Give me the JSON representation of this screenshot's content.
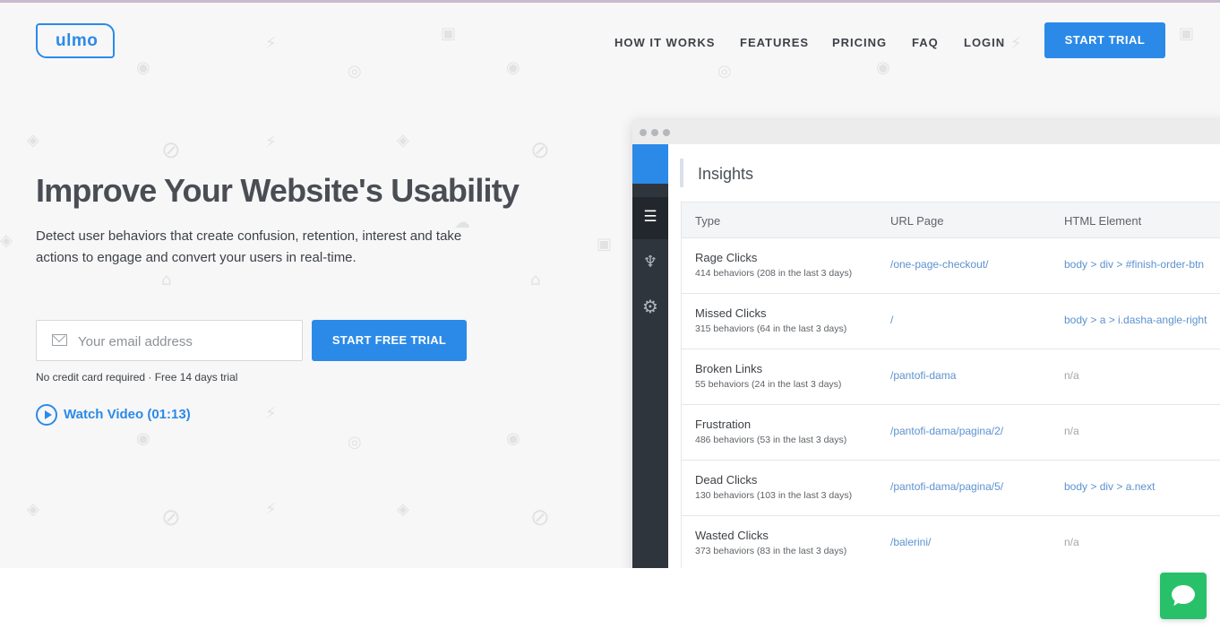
{
  "brand": {
    "logo_text": "ulmo",
    "accent_color": "#2b8ae8",
    "chat_color": "#28c16a"
  },
  "nav": {
    "items": [
      {
        "label": "HOW IT WORKS"
      },
      {
        "label": "FEATURES"
      },
      {
        "label": "PRICING"
      },
      {
        "label": "FAQ"
      },
      {
        "label": "LOGIN"
      }
    ],
    "cta_label": "START TRIAL"
  },
  "hero": {
    "title": "Improve Your Website's Usability",
    "lead": "Detect user behaviors that create confusion, retention, interest and take actions to engage and convert your users in real-time.",
    "email_placeholder": "Your email address",
    "trial_label": "START FREE TRIAL",
    "note": "No credit card required · Free 14 days trial",
    "video_label": "Watch Video (01:13)"
  },
  "insights": {
    "title": "Insights",
    "sidebar_icons": [
      "list-icon",
      "sitemap-icon",
      "gear-icon"
    ],
    "columns": [
      "Type",
      "URL Page",
      "HTML Element"
    ],
    "rows": [
      {
        "type": "Rage Clicks",
        "sub": "414 behaviors (208 in the last 3 days)",
        "url": "/one-page-checkout/",
        "element": "body > div > #finish-order-btn"
      },
      {
        "type": "Missed Clicks",
        "sub": "315 behaviors (64 in the last 3 days)",
        "url": "/",
        "element": "body > a > i.dasha-angle-right"
      },
      {
        "type": "Broken Links",
        "sub": "55 behaviors (24 in the last 3 days)",
        "url": "/pantofi-dama",
        "element": "n/a"
      },
      {
        "type": "Frustration",
        "sub": "486 behaviors (53 in the last 3 days)",
        "url": "/pantofi-dama/pagina/2/",
        "element": "n/a"
      },
      {
        "type": "Dead Clicks",
        "sub": "130 behaviors (103 in the last 3 days)",
        "url": "/pantofi-dama/pagina/5/",
        "element": "body > div > a.next"
      },
      {
        "type": "Wasted Clicks",
        "sub": "373 behaviors (83 in the last 3 days)",
        "url": "/balerini/",
        "element": "n/a"
      }
    ]
  },
  "chat": {
    "icon": "chat-bubble-icon"
  }
}
